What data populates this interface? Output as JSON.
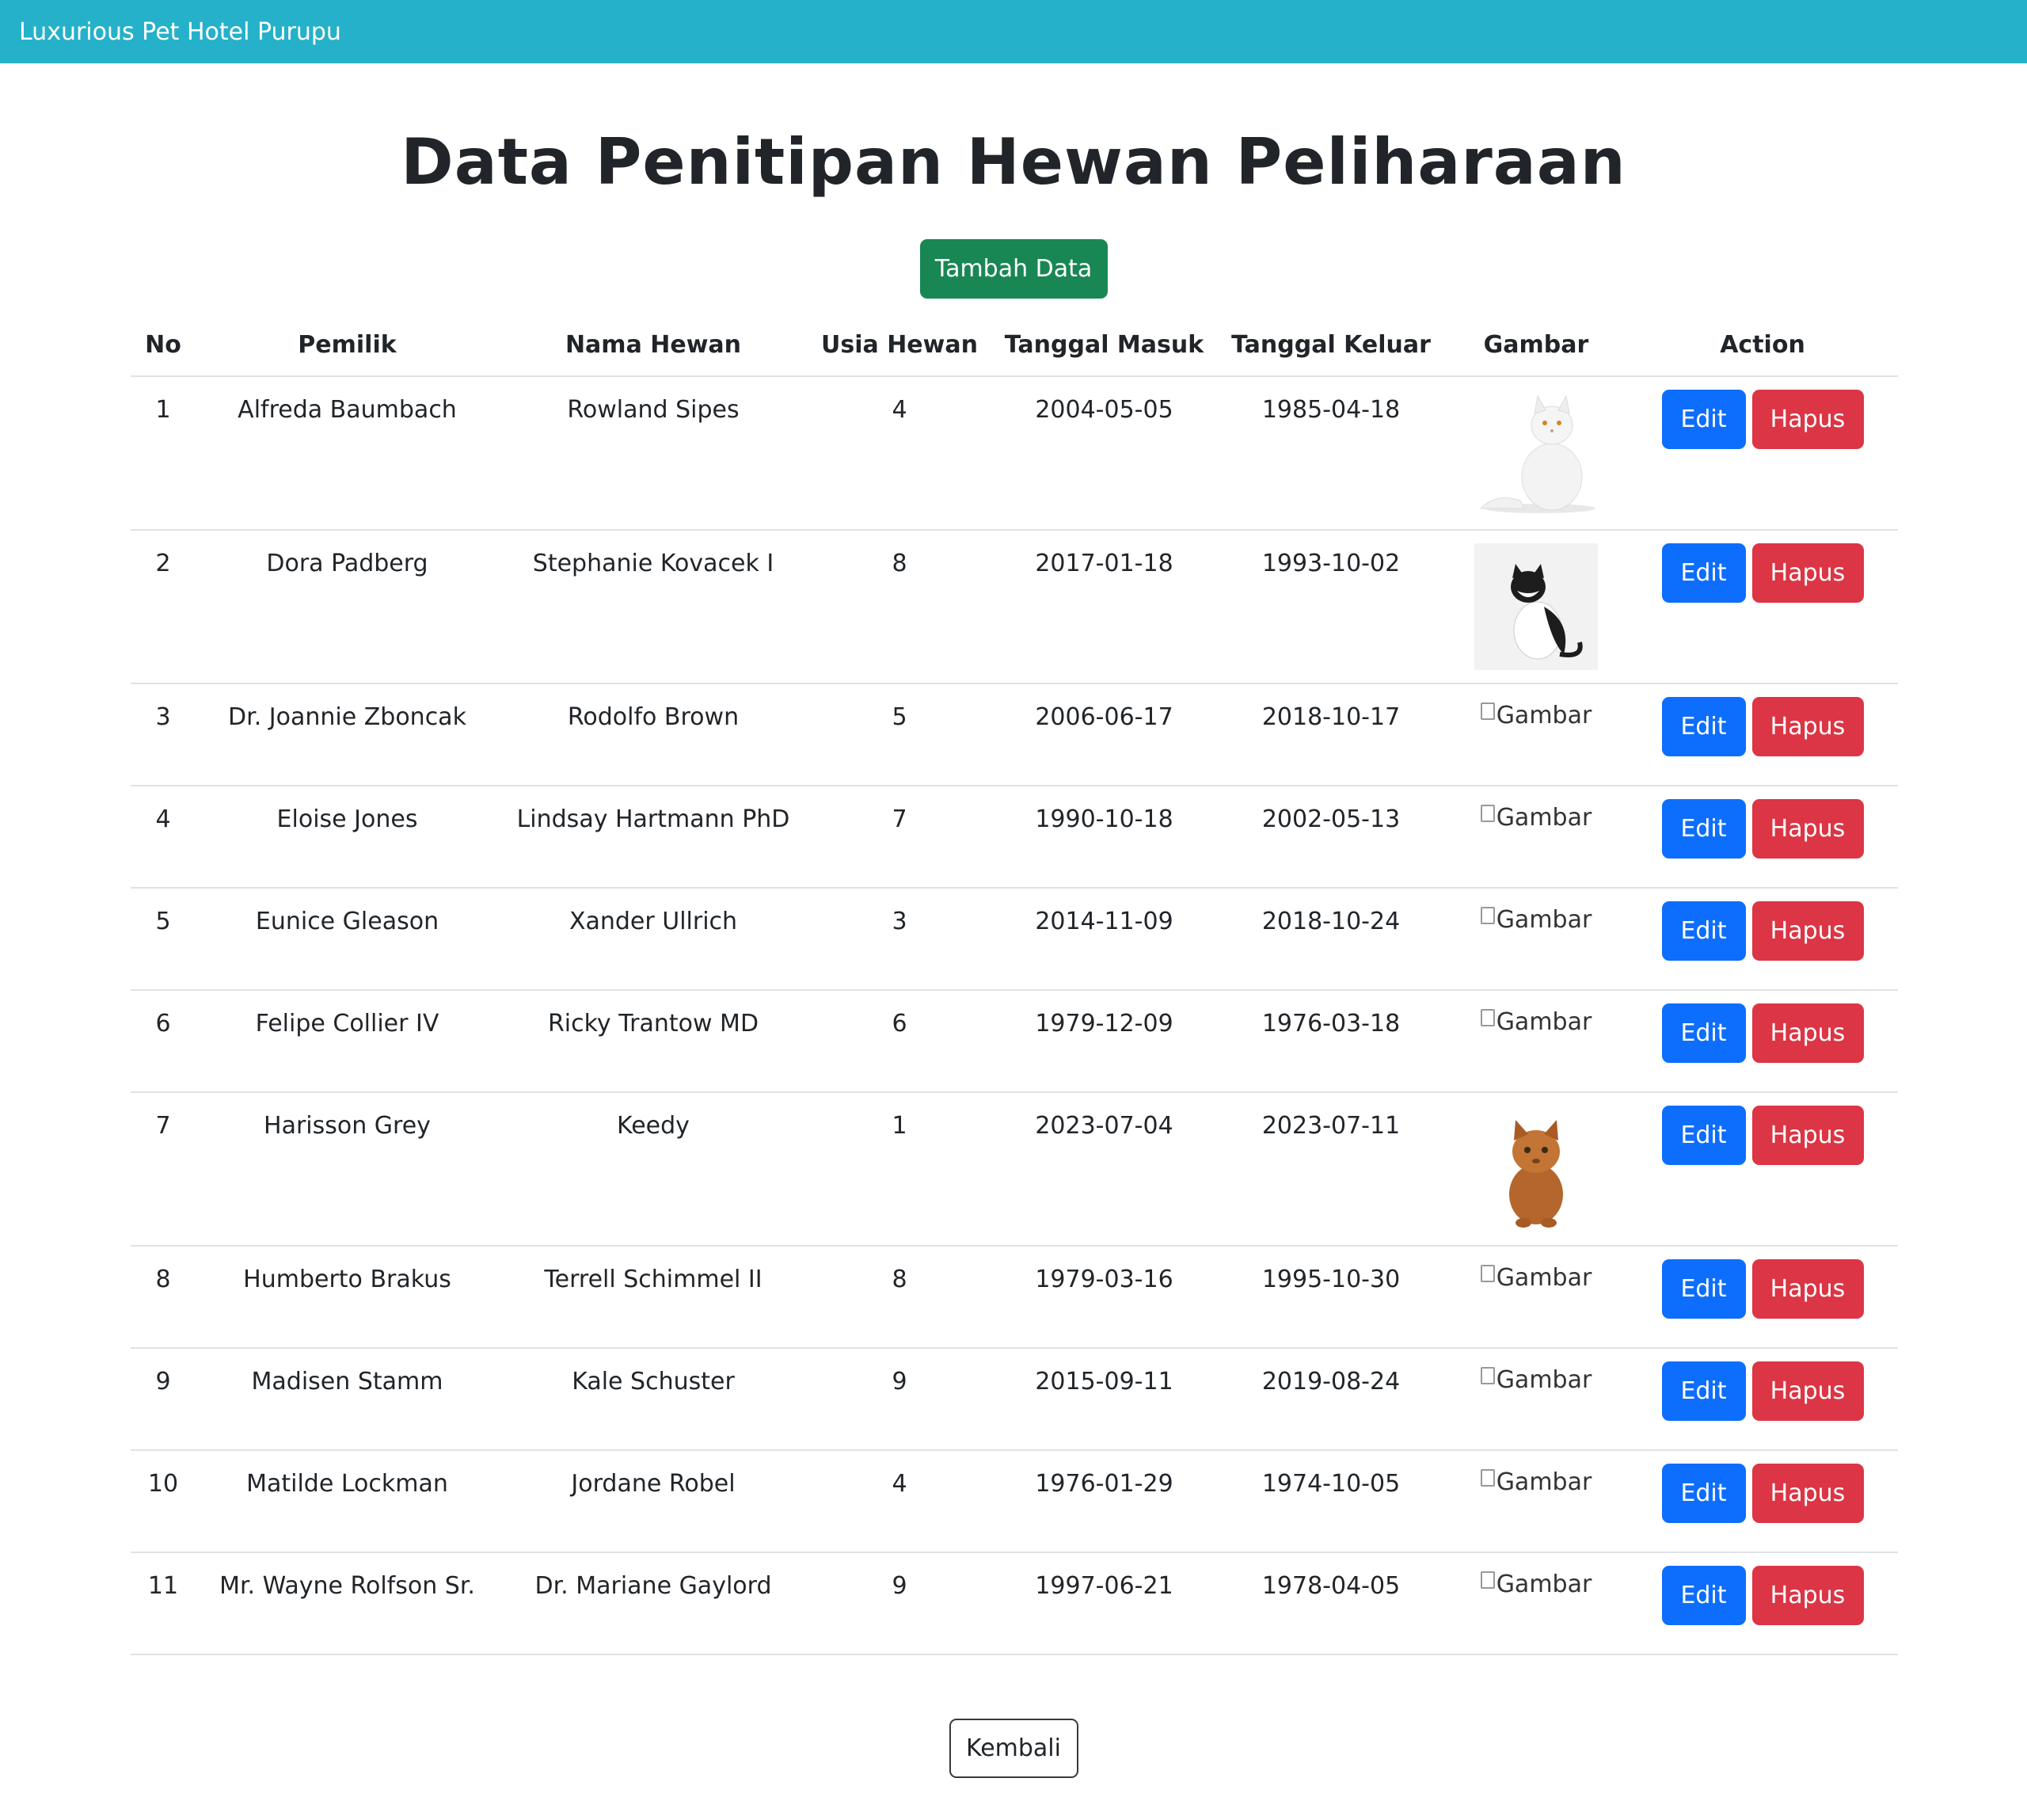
{
  "navbar": {
    "brand": "Luxurious Pet Hotel Purupu"
  },
  "page": {
    "title": "Data Penitipan Hewan Peliharaan",
    "add_button": "Tambah Data",
    "back_button": "Kembali"
  },
  "table": {
    "headers": [
      "No",
      "Pemilik",
      "Nama Hewan",
      "Usia Hewan",
      "Tanggal Masuk",
      "Tanggal Keluar",
      "Gambar",
      "Action"
    ],
    "edit_label": "Edit",
    "delete_label": "Hapus",
    "image_alt": "Gambar",
    "rows": [
      {
        "no": "1",
        "pemilik": "Alfreda Baumbach",
        "nama": "Rowland Sipes",
        "usia": "4",
        "masuk": "2004-05-05",
        "keluar": "1985-04-18",
        "image": "white-cat"
      },
      {
        "no": "2",
        "pemilik": "Dora Padberg",
        "nama": "Stephanie Kovacek I",
        "usia": "8",
        "masuk": "2017-01-18",
        "keluar": "1993-10-02",
        "image": "black-white-cat"
      },
      {
        "no": "3",
        "pemilik": "Dr. Joannie Zboncak",
        "nama": "Rodolfo Brown",
        "usia": "5",
        "masuk": "2006-06-17",
        "keluar": "2018-10-17",
        "image": "broken"
      },
      {
        "no": "4",
        "pemilik": "Eloise Jones",
        "nama": "Lindsay Hartmann PhD",
        "usia": "7",
        "masuk": "1990-10-18",
        "keluar": "2002-05-13",
        "image": "broken"
      },
      {
        "no": "5",
        "pemilik": "Eunice Gleason",
        "nama": "Xander Ullrich",
        "usia": "3",
        "masuk": "2014-11-09",
        "keluar": "2018-10-24",
        "image": "broken"
      },
      {
        "no": "6",
        "pemilik": "Felipe Collier IV",
        "nama": "Ricky Trantow MD",
        "usia": "6",
        "masuk": "1979-12-09",
        "keluar": "1976-03-18",
        "image": "broken"
      },
      {
        "no": "7",
        "pemilik": "Harisson Grey",
        "nama": "Keedy",
        "usia": "1",
        "masuk": "2023-07-04",
        "keluar": "2023-07-11",
        "image": "orange-kitten"
      },
      {
        "no": "8",
        "pemilik": "Humberto Brakus",
        "nama": "Terrell Schimmel II",
        "usia": "8",
        "masuk": "1979-03-16",
        "keluar": "1995-10-30",
        "image": "broken"
      },
      {
        "no": "9",
        "pemilik": "Madisen Stamm",
        "nama": "Kale Schuster",
        "usia": "9",
        "masuk": "2015-09-11",
        "keluar": "2019-08-24",
        "image": "broken"
      },
      {
        "no": "10",
        "pemilik": "Matilde Lockman",
        "nama": "Jordane Robel",
        "usia": "4",
        "masuk": "1976-01-29",
        "keluar": "1974-10-05",
        "image": "broken"
      },
      {
        "no": "11",
        "pemilik": "Mr. Wayne Rolfson Sr.",
        "nama": "Dr. Mariane Gaylord",
        "usia": "9",
        "masuk": "1997-06-21",
        "keluar": "1978-04-05",
        "image": "broken"
      }
    ]
  },
  "colors": {
    "navbar": "#25b1c9",
    "success": "#198754",
    "primary": "#0d6efd",
    "danger": "#dc3545"
  }
}
